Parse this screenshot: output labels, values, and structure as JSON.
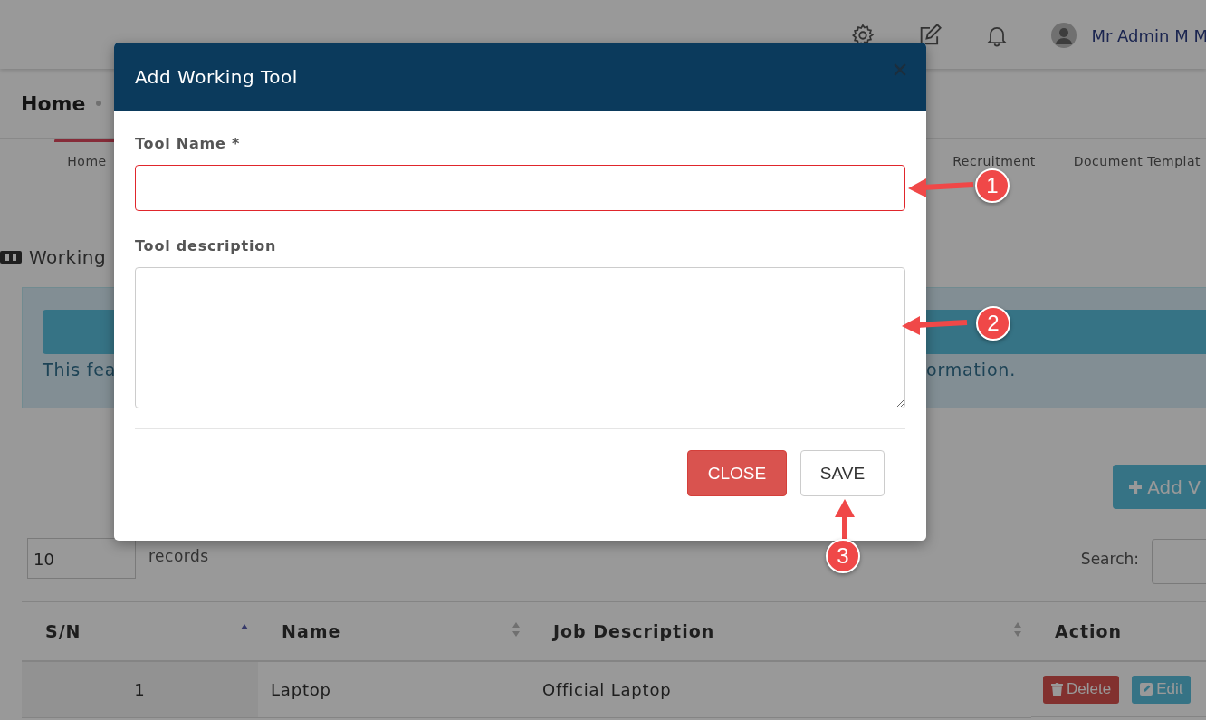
{
  "header": {
    "user_name": "Mr Admin M M"
  },
  "breadcrumb": {
    "title": "Home"
  },
  "nav_tabs": [
    {
      "label": "Home",
      "selected": true
    },
    {
      "label": "Recruitment",
      "selected": false
    },
    {
      "label": "Document Templat",
      "selected": false
    }
  ],
  "section_title": "Working",
  "notice": {
    "text_start": "This fea",
    "text_end": "ormation."
  },
  "add_button": "Add V",
  "length_select": {
    "value": "10",
    "label": "records"
  },
  "search": {
    "label": "Search:"
  },
  "table": {
    "columns": [
      {
        "label": "S/N",
        "sortable": true,
        "sorted": true
      },
      {
        "label": "Name",
        "sortable": true,
        "sorted": false
      },
      {
        "label": "Job Description",
        "sortable": true,
        "sorted": false
      },
      {
        "label": "Action",
        "sortable": false
      }
    ],
    "rows": [
      {
        "cells": [
          "1",
          "Laptop",
          "Official Laptop"
        ],
        "actions": [
          {
            "label": "Delete",
            "kind": "delete"
          },
          {
            "label": "Edit",
            "kind": "edit"
          }
        ]
      }
    ]
  },
  "modal": {
    "title": "Add Working Tool",
    "fields": [
      {
        "label": "Tool Name *",
        "kind": "input",
        "invalid": true
      },
      {
        "label": "Tool description",
        "kind": "textarea",
        "invalid": false
      }
    ],
    "buttons": [
      {
        "label": "CLOSE",
        "kind": "danger"
      },
      {
        "label": "SAVE",
        "kind": "default"
      }
    ]
  },
  "annotations": [
    {
      "number": "1"
    },
    {
      "number": "2"
    },
    {
      "number": "3"
    }
  ]
}
